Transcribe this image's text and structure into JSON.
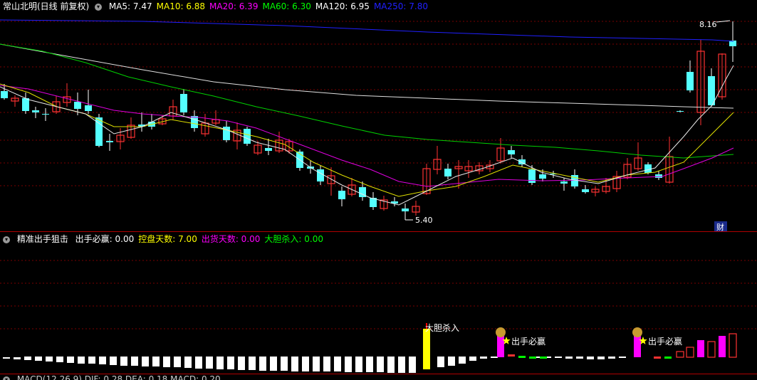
{
  "main": {
    "title": "常山北明(日线 前复权)",
    "ma": [
      {
        "label": "MA5: 7.47",
        "color": "#ffffff"
      },
      {
        "label": "MA10: 6.88",
        "color": "#ffff00"
      },
      {
        "label": "MA20: 6.39",
        "color": "#ff00ff"
      },
      {
        "label": "MA60: 6.30",
        "color": "#00ff00"
      },
      {
        "label": "MA120: 6.95",
        "color": "#ffffff"
      },
      {
        "label": "MA250: 7.80",
        "color": "#2020ff"
      }
    ],
    "high_label": "8.16",
    "low_label": "5.40",
    "badge": "财"
  },
  "indicator": {
    "name": "精准出手狙击",
    "values": [
      {
        "label": "出手必赢: 0.00",
        "color": "#ffffff"
      },
      {
        "label": "控盘天数: 7.00",
        "color": "#ffff00"
      },
      {
        "label": "出货天数: 0.00",
        "color": "#ff00ff"
      },
      {
        "label": "大胆杀入: 0.00",
        "color": "#00ff00"
      }
    ],
    "tag_bold": "大胆杀入",
    "tag_win_1": "出手必赢",
    "tag_win_2": "出手必赢"
  },
  "macd": {
    "label": "MACD(12,26,9)  DIF: 0.28  DEA: 0.18  MACD: 0.20"
  },
  "colors": {
    "up": "#ff3232",
    "down": "#54ffff",
    "grid": "#7a0000",
    "border": "#b00000"
  }
}
